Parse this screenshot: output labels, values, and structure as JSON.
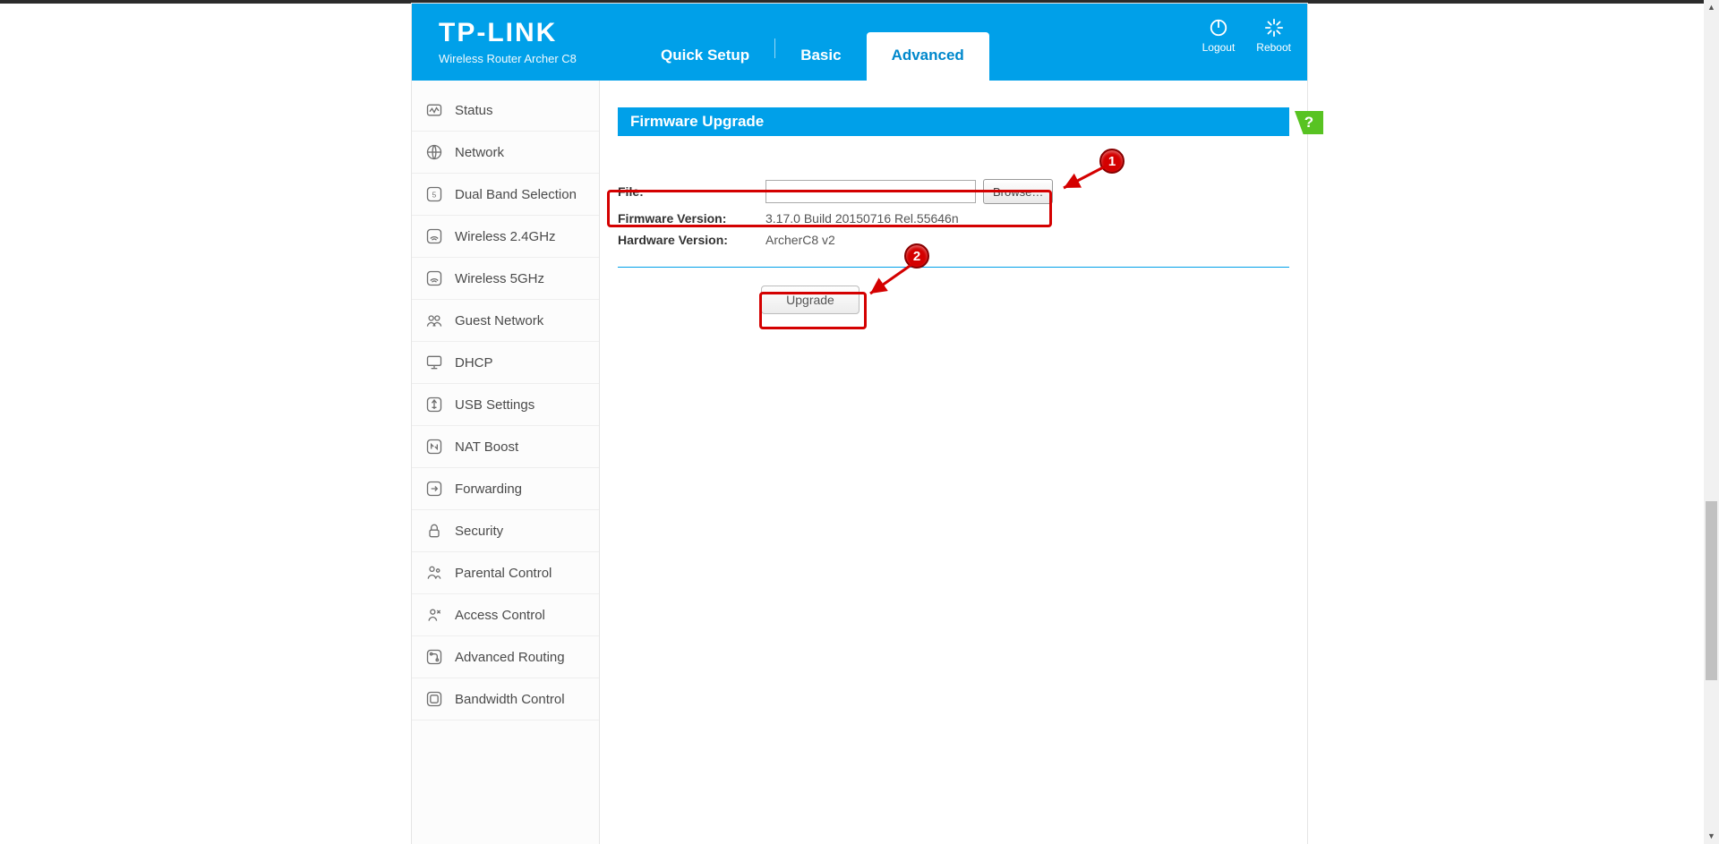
{
  "brand": {
    "name": "TP-LINK",
    "subtitle": "Wireless Router Archer C8"
  },
  "tabs": {
    "quick_setup": "Quick Setup",
    "basic": "Basic",
    "advanced": "Advanced"
  },
  "header_actions": {
    "logout": "Logout",
    "reboot": "Reboot"
  },
  "sidebar": {
    "items": [
      {
        "id": "status",
        "label": "Status"
      },
      {
        "id": "network",
        "label": "Network"
      },
      {
        "id": "dual-band",
        "label": "Dual Band Selection"
      },
      {
        "id": "wireless-24",
        "label": "Wireless 2.4GHz"
      },
      {
        "id": "wireless-5",
        "label": "Wireless 5GHz"
      },
      {
        "id": "guest-network",
        "label": "Guest Network"
      },
      {
        "id": "dhcp",
        "label": "DHCP"
      },
      {
        "id": "usb-settings",
        "label": "USB Settings"
      },
      {
        "id": "nat-boost",
        "label": "NAT Boost"
      },
      {
        "id": "forwarding",
        "label": "Forwarding"
      },
      {
        "id": "security",
        "label": "Security"
      },
      {
        "id": "parental-control",
        "label": "Parental Control"
      },
      {
        "id": "access-control",
        "label": "Access Control"
      },
      {
        "id": "advanced-routing",
        "label": "Advanced Routing"
      },
      {
        "id": "bandwidth-control",
        "label": "Bandwidth Control"
      }
    ]
  },
  "panel": {
    "title": "Firmware Upgrade",
    "file_label": "File:",
    "browse_label": "Browse…",
    "fw_label": "Firmware Version:",
    "fw_value": "3.17.0 Build 20150716 Rel.55646n",
    "hw_label": "Hardware Version:",
    "hw_value": "ArcherC8 v2",
    "upgrade_label": "Upgrade"
  },
  "annotations": {
    "step1": "1",
    "step2": "2"
  },
  "help": {
    "label": "?"
  }
}
